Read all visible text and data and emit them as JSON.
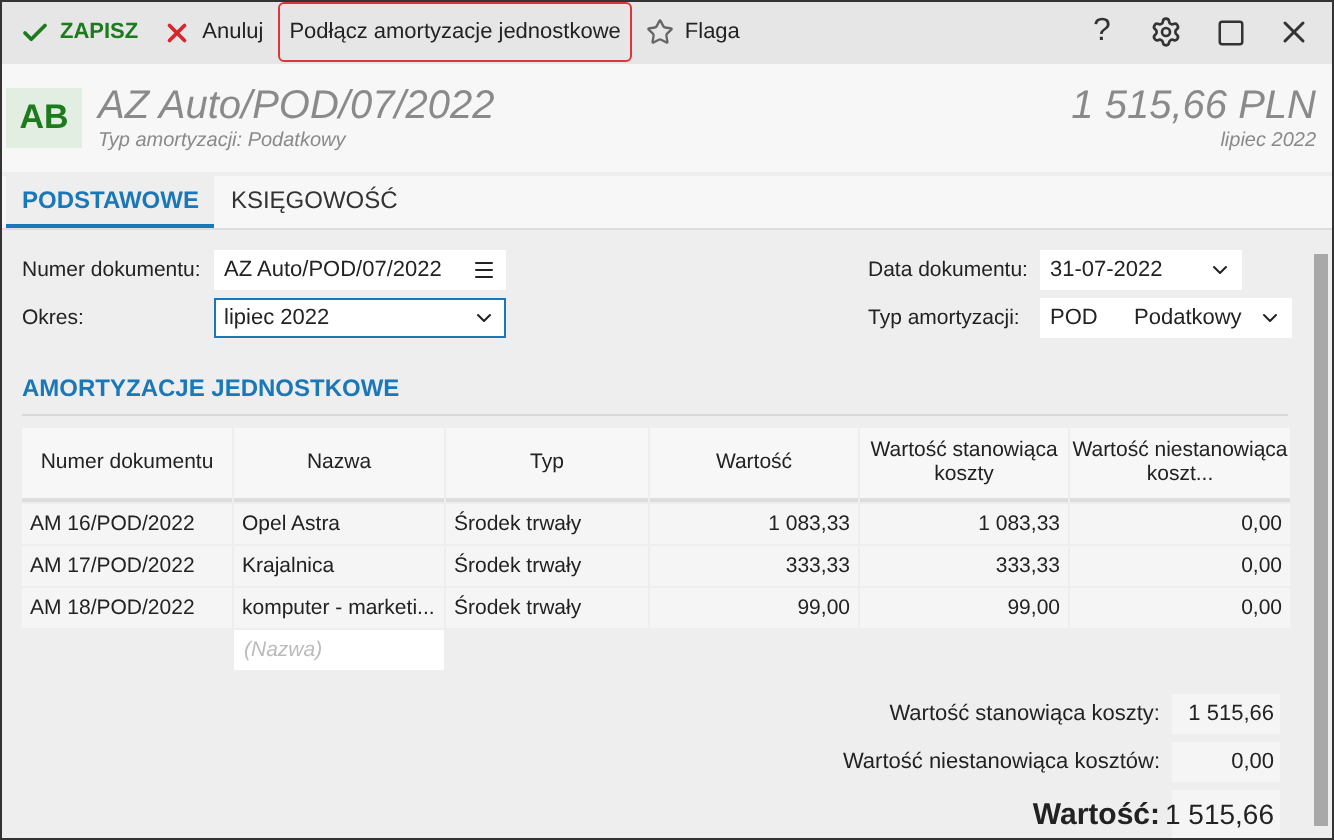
{
  "toolbar": {
    "actions": [
      {
        "kind": "save",
        "label": "ZAPISZ",
        "outlined": false
      },
      {
        "kind": "cancel",
        "label": "Anuluj",
        "outlined": false
      },
      {
        "kind": "plain",
        "label": "Podłącz amortyzacje jednostkowe",
        "outlined": true
      },
      {
        "kind": "flag",
        "label": "Flaga",
        "outlined": false
      }
    ],
    "help": "?"
  },
  "header": {
    "badge": "AB",
    "title": "AZ Auto/POD/07/2022",
    "subtitle": "Typ amortyzacji: Podatkowy",
    "amount": "1 515,66 PLN",
    "period": "lipiec 2022"
  },
  "tabs": [
    {
      "label": "PODSTAWOWE",
      "selected": true
    },
    {
      "label": "KSIĘGOWOŚĆ",
      "selected": false
    }
  ],
  "form": {
    "number": {
      "label": "Numer dokumentu:",
      "value": "AZ Auto/POD/07/2022"
    },
    "period": {
      "label": "Okres:",
      "value": "lipiec 2022",
      "focused": true
    },
    "date": {
      "label": "Data dokumentu:",
      "value": "31-07-2022"
    },
    "type": {
      "label": "Typ amortyzacji:",
      "code": "POD",
      "value": "Podatkowy"
    }
  },
  "section_title": "AMORTYZACJE JEDNOSTKOWE",
  "table": {
    "columns": [
      "Numer dokumentu",
      "Nazwa",
      "Typ",
      "Wartość",
      "Wartość stanowiąca koszty",
      "Wartość niestanowiąca koszt..."
    ],
    "rows": [
      [
        "AM 16/POD/2022",
        "Opel Astra",
        "Środek trwały",
        "1 083,33",
        "1 083,33",
        "0,00"
      ],
      [
        "AM 17/POD/2022",
        "Krajalnica",
        "Środek trwały",
        "333,33",
        "333,33",
        "0,00"
      ],
      [
        "AM 18/POD/2022",
        "komputer - marketi...",
        "Środek trwały",
        "99,00",
        "99,00",
        "0,00"
      ]
    ],
    "new_row_placeholder": "(Nazwa)"
  },
  "totals": [
    {
      "label": "Wartość stanowiąca koszty:",
      "value": "1 515,66",
      "kind": "normal"
    },
    {
      "label": "Wartość niestanowiąca kosztów:",
      "value": "0,00",
      "kind": "normal"
    },
    {
      "label": "Wartość:",
      "value": "1 515,66",
      "kind": "grand"
    }
  ]
}
